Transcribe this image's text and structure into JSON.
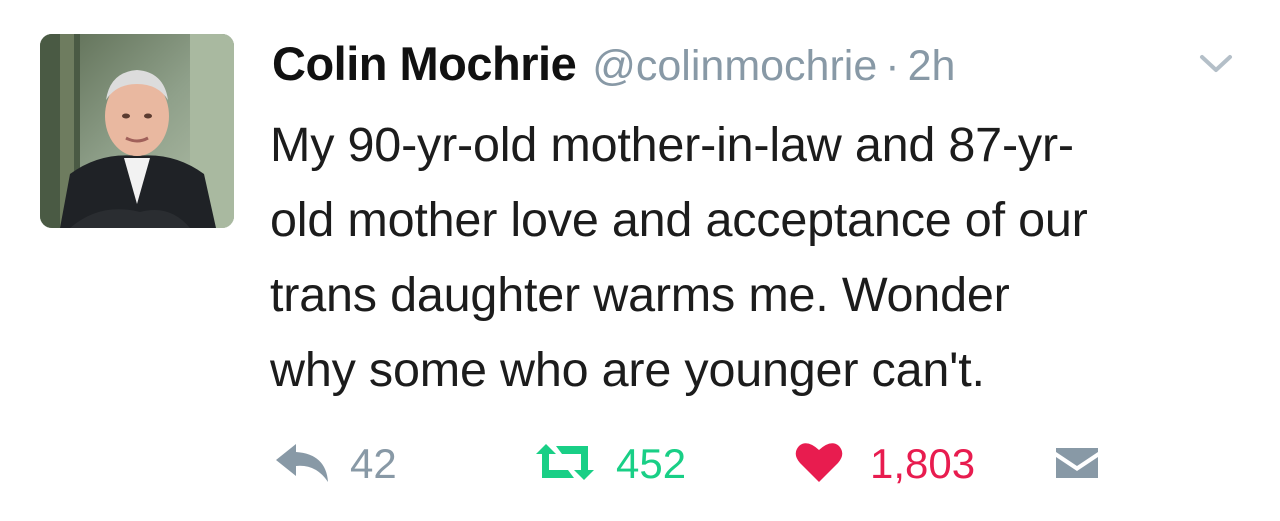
{
  "tweet": {
    "author": {
      "name": "Colin Mochrie",
      "handle": "@colinmochrie",
      "separator": "·",
      "timestamp": "2h"
    },
    "text_lines": [
      "My 90-yr-old mother-in-law and 87-yr-",
      "old mother love and acceptance of our",
      "trans daughter warms me. Wonder",
      "why some who are younger can't."
    ],
    "actions": {
      "replies": "42",
      "retweets": "452",
      "likes": "1,803"
    }
  },
  "icons": {
    "caret": "chevron-down-icon",
    "reply": "reply-icon",
    "retweet": "retweet-icon",
    "like": "heart-icon",
    "dm": "envelope-icon"
  },
  "colors": {
    "muted": "#8899a6",
    "retweet": "#19cf86",
    "like": "#e81c4f",
    "text": "#1c1c1c"
  }
}
